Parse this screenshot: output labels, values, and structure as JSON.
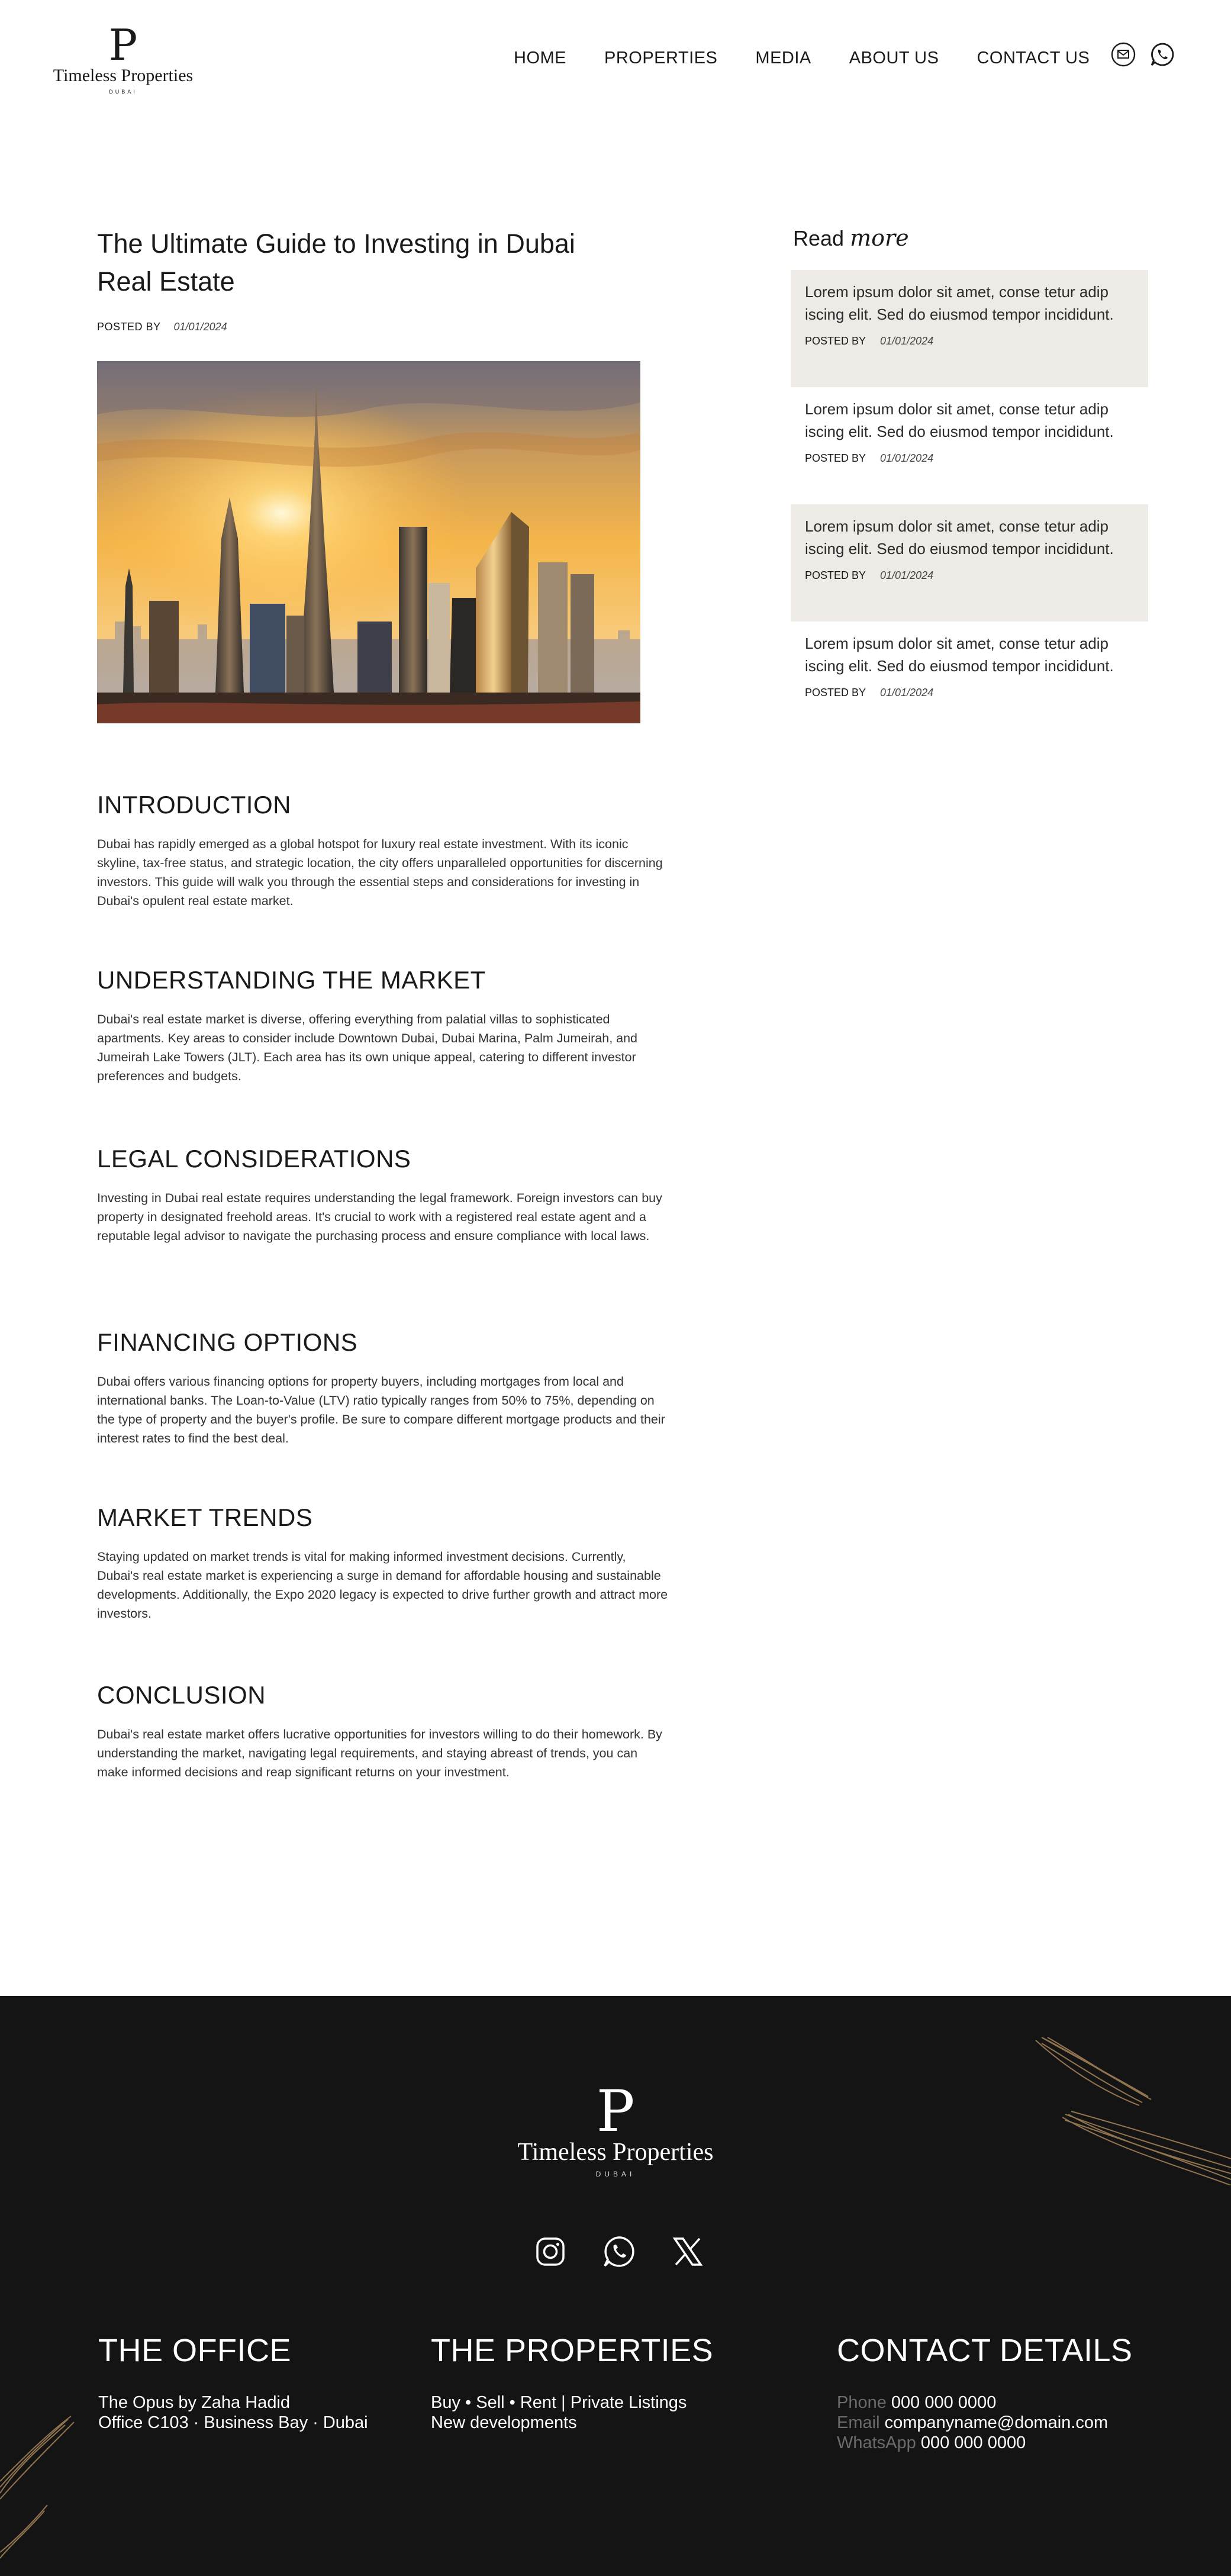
{
  "brand": {
    "mark": "P",
    "name": "Timeless Properties",
    "location": "DUBAI"
  },
  "nav": {
    "items": [
      "HOME",
      "PROPERTIES",
      "MEDIA",
      "ABOUT US",
      "CONTACT US"
    ]
  },
  "header_icons": [
    "email-icon",
    "whatsapp-icon"
  ],
  "article": {
    "title": "The Ultimate Guide to Investing in Dubai Real Estate",
    "posted_by_label": "POSTED BY",
    "date": "01/01/2024",
    "sections": [
      {
        "heading": "INTRODUCTION",
        "body": "Dubai has rapidly emerged as a global hotspot for luxury real estate investment. With its iconic skyline, tax-free status, and strategic location, the city offers unparalleled opportunities for discerning investors. This guide will walk you through the essential steps and considerations for investing in Dubai's opulent real estate market."
      },
      {
        "heading": "UNDERSTANDING THE MARKET",
        "body": "Dubai's real estate market is diverse, offering everything from palatial villas to sophisticated apartments. Key areas to consider include Downtown Dubai, Dubai Marina, Palm Jumeirah, and Jumeirah Lake Towers (JLT). Each area has its own unique appeal, catering to different investor preferences and budgets."
      },
      {
        "heading": "LEGAL CONSIDERATIONS",
        "body": "Investing in Dubai real estate requires understanding the legal framework. Foreign investors can buy property in designated freehold areas. It's crucial to work with a registered real estate agent and a reputable legal advisor to navigate the purchasing process and ensure compliance with local laws."
      },
      {
        "heading": "FINANCING OPTIONS",
        "body": "Dubai offers various financing options for property buyers, including mortgages from local and international banks. The Loan-to-Value (LTV) ratio typically ranges from 50% to 75%, depending on the type of property and the buyer's profile. Be sure to compare different mortgage products and their interest rates to find the best deal."
      },
      {
        "heading": "MARKET TRENDS",
        "body": "Staying updated on market trends is vital for making informed investment decisions. Currently, Dubai's real estate market is experiencing a surge in demand for affordable housing and sustainable developments. Additionally, the Expo 2020 legacy is expected to drive further growth and attract more investors."
      },
      {
        "heading": "CONCLUSION",
        "body": "Dubai's real estate market offers lucrative opportunities for investors willing to do their homework. By understanding the market, navigating legal requirements, and staying abreast of trends, you can make informed decisions and reap significant returns on your investment."
      }
    ]
  },
  "sidebar": {
    "read_label": "Read",
    "more_label": "more",
    "posts": [
      {
        "text": "Lorem ipsum dolor sit amet, conse tetur adip iscing elit. Sed do eiusmod tempor incididunt.",
        "posted_by_label": "POSTED BY",
        "date": "01/01/2024"
      },
      {
        "text": "Lorem ipsum dolor sit amet, conse tetur adip iscing elit. Sed do eiusmod tempor incididunt.",
        "posted_by_label": "POSTED BY",
        "date": "01/01/2024"
      },
      {
        "text": "Lorem ipsum dolor sit amet, conse tetur adip iscing elit. Sed do eiusmod tempor incididunt.",
        "posted_by_label": "POSTED BY",
        "date": "01/01/2024"
      },
      {
        "text": "Lorem ipsum dolor sit amet, conse tetur adip iscing elit. Sed do eiusmod tempor incididunt.",
        "posted_by_label": "POSTED BY",
        "date": "01/01/2024"
      }
    ]
  },
  "footer": {
    "social_icons": [
      "instagram-icon",
      "whatsapp-icon",
      "x-icon"
    ],
    "office": {
      "heading": "THE OFFICE",
      "line1": "The Opus by Zaha Hadid",
      "line2": "Office C103 · Business Bay · Dubai"
    },
    "properties": {
      "heading": "THE PROPERTIES",
      "line1": "Buy • Sell • Rent | Private Listings",
      "line2": "New developments"
    },
    "contact": {
      "heading": "CONTACT DETAILS",
      "phone_label": "Phone",
      "phone": "000 000 0000",
      "email_label": "Email",
      "email": "companyname@domain.com",
      "whatsapp_label": "WhatsApp",
      "whatsapp": "000 000 0000"
    }
  },
  "colors": {
    "footer_bg": "#141414",
    "card_shade": "#eeebe6",
    "gold": "#a8875a"
  }
}
